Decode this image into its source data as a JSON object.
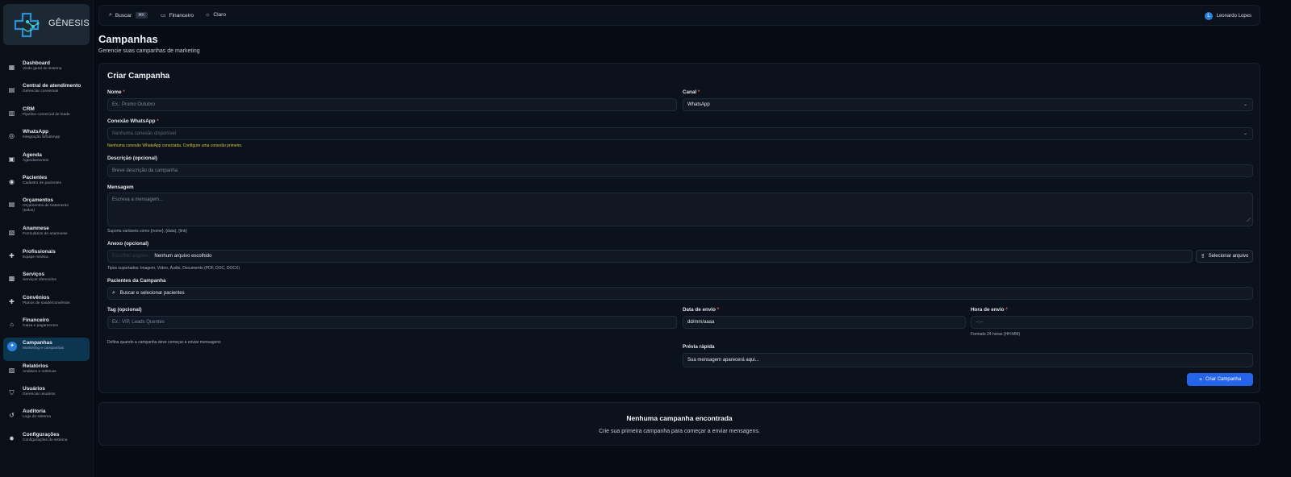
{
  "app": {
    "logo_text": "GÊNESIS"
  },
  "sidebar": {
    "items": [
      {
        "title": "Dashboard",
        "sub": "Visão geral do sistema",
        "icon": "dashboard-icon",
        "glyph": "▦"
      },
      {
        "title": "Central de atendimento",
        "sub": "Gerenciar conversas",
        "icon": "chat-icon",
        "glyph": "▤"
      },
      {
        "title": "CRM",
        "sub": "Pipeline comercial de leads",
        "icon": "columns-icon",
        "glyph": "▥"
      },
      {
        "title": "WhatsApp",
        "sub": "Integração WhatsApp",
        "icon": "whatsapp-icon",
        "glyph": "◎"
      },
      {
        "title": "Agenda",
        "sub": "Agendamentos",
        "icon": "calendar-icon",
        "glyph": "▣"
      },
      {
        "title": "Pacientes",
        "sub": "Cadastro de pacientes",
        "icon": "users-icon",
        "glyph": "◉"
      },
      {
        "title": "Orçamentos",
        "sub": "Orçamentos de tratamento (todos)",
        "icon": "document-icon",
        "glyph": "▤"
      },
      {
        "title": "Anamnese",
        "sub": "Formulários de anamnese",
        "icon": "clipboard-icon",
        "glyph": "▧"
      },
      {
        "title": "Profissionais",
        "sub": "Equipe médica",
        "icon": "medical-plus-icon",
        "glyph": "✚"
      },
      {
        "title": "Serviços",
        "sub": "Serviços oferecidos",
        "icon": "briefcase-icon",
        "glyph": "▩"
      },
      {
        "title": "Convênios",
        "sub": "Planos de saúde/convênios",
        "icon": "health-plan-icon",
        "glyph": "✚"
      },
      {
        "title": "Financeiro",
        "sub": "Caixa e pagamentos",
        "icon": "bank-icon",
        "glyph": "⌂"
      },
      {
        "title": "Campanhas",
        "sub": "Marketing e campanhas",
        "icon": "campaign-icon",
        "glyph": "✦"
      },
      {
        "title": "Relatórios",
        "sub": "Análises e métricas",
        "icon": "chart-icon",
        "glyph": "▨"
      },
      {
        "title": "Usuários",
        "sub": "Gerenciar usuários",
        "icon": "shield-user-icon",
        "glyph": "⛉"
      },
      {
        "title": "Auditoria",
        "sub": "Logs do sistema",
        "icon": "history-icon",
        "glyph": "↺"
      },
      {
        "title": "Configurações",
        "sub": "Configurações do sistema",
        "icon": "gear-icon",
        "glyph": "✹"
      }
    ]
  },
  "topbar": {
    "search_label": "Buscar",
    "search_shortcut": "⌘K",
    "financeiro_label": "Financeiro",
    "theme_label": "Claro",
    "user_initial": "L",
    "user_name": "Leonardo Lopes"
  },
  "page": {
    "title": "Campanhas",
    "subtitle": "Gerencie suas campanhas de marketing"
  },
  "form": {
    "title": "Criar Campanha",
    "nome_label": "Nome",
    "nome_placeholder": "Ex.: Promo Outubro",
    "canal_label": "Canal",
    "canal_value": "WhatsApp",
    "conexao_label": "Conexão WhatsApp",
    "conexao_value": "Nenhuma conexão disponível",
    "conexao_warning": "Nenhuma conexão WhatsApp conectada. Configure uma conexão primeiro.",
    "descricao_label": "Descrição (opcional)",
    "descricao_placeholder": "Breve descrição da campanha",
    "mensagem_label": "Mensagem",
    "mensagem_placeholder": "Escreva a mensagem...",
    "mensagem_hint": "Suporta variáveis como {nome}, {data}, {link}",
    "anexo_label": "Anexo (opcional)",
    "anexo_button_inline": "Escolher arquivo",
    "anexo_file": "Nenhum arquivo escolhido",
    "anexo_select_button": "Selecionar arquivo",
    "anexo_hint": "Tipos suportados: Imagem, Vídeo, Áudio, Documento (PDF, DOC, DOCX)",
    "pacientes_label": "Pacientes da Campanha",
    "pacientes_placeholder": "Buscar e selecionar pacientes",
    "tag_label": "Tag (opcional)",
    "tag_placeholder": "Ex.: VIP, Leads Quentes",
    "tag_hint": "Defina quando a campanha deve começar a enviar mensagens",
    "data_label": "Data de envio",
    "data_placeholder": "dd/mm/aaaa",
    "hora_label": "Hora de envio",
    "hora_placeholder": "--:--",
    "hora_hint": "Formato 24 horas (HH:MM)",
    "previa_label": "Prévia rápida",
    "previa_text": "Sua mensagem aparecerá aqui...",
    "submit_label": "Criar Campanha",
    "required_mark": "*"
  },
  "empty_state": {
    "title": "Nenhuma campanha encontrada",
    "subtitle": "Crie sua primeira campanha para começar a enviar mensagens."
  }
}
